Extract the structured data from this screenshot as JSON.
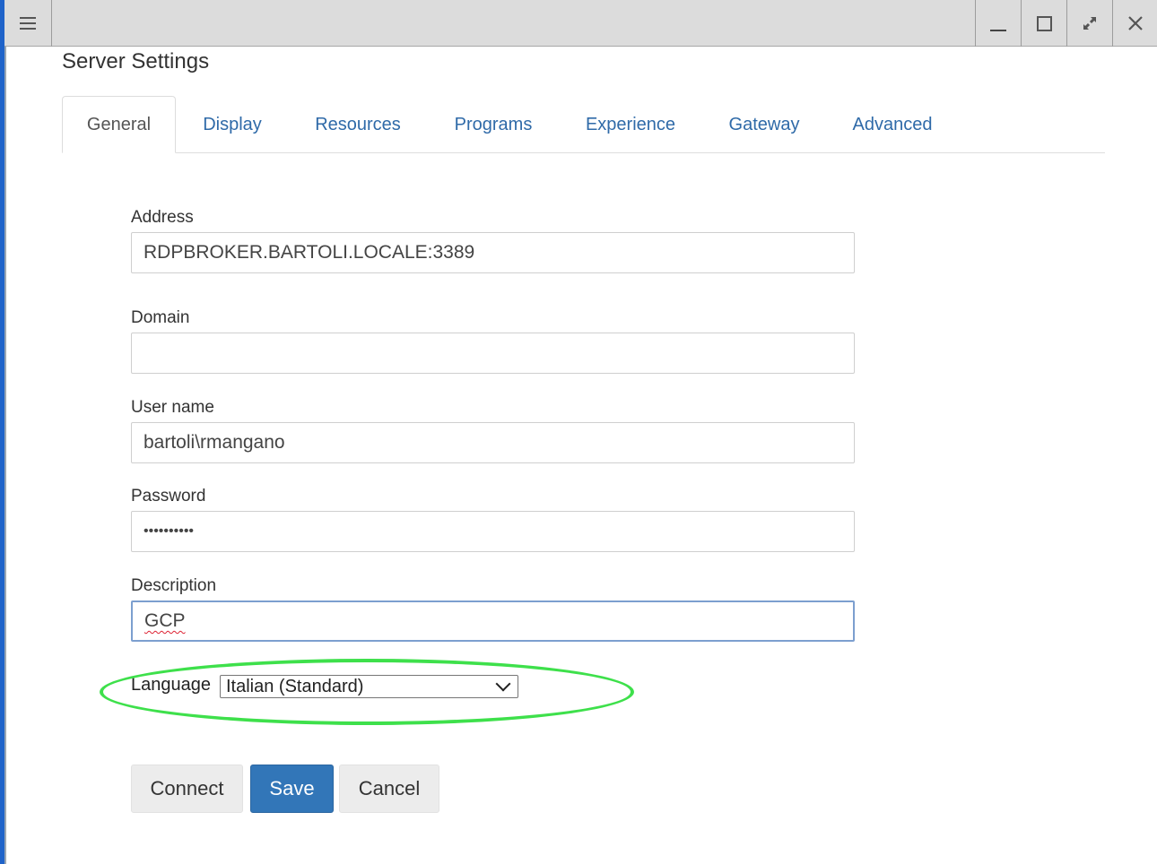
{
  "window": {
    "controls": {
      "menu_icon": "hamburger-icon",
      "minimize_icon": "minimize-icon",
      "maximize_icon": "maximize-icon",
      "restore_icon": "restore-icon",
      "close_icon": "close-icon"
    }
  },
  "page": {
    "title": "Server Settings"
  },
  "tabs": [
    {
      "label": "General",
      "active": true
    },
    {
      "label": "Display",
      "active": false
    },
    {
      "label": "Resources",
      "active": false
    },
    {
      "label": "Programs",
      "active": false
    },
    {
      "label": "Experience",
      "active": false
    },
    {
      "label": "Gateway",
      "active": false
    },
    {
      "label": "Advanced",
      "active": false
    }
  ],
  "form": {
    "address": {
      "label": "Address",
      "value": "RDPBROKER.BARTOLI.LOCALE:3389"
    },
    "domain": {
      "label": "Domain",
      "value": ""
    },
    "username": {
      "label": "User name",
      "value": "bartoli\\rmangano"
    },
    "password": {
      "label": "Password",
      "value": "••••••••••"
    },
    "description": {
      "label": "Description",
      "value": "GCP"
    },
    "language": {
      "label": "Language",
      "selected": "Italian (Standard)"
    }
  },
  "buttons": {
    "connect": "Connect",
    "save": "Save",
    "cancel": "Cancel"
  },
  "colors": {
    "accent": "#3276b8",
    "tab_link": "#2f6aa8",
    "highlight_ellipse": "#3ee04b"
  }
}
